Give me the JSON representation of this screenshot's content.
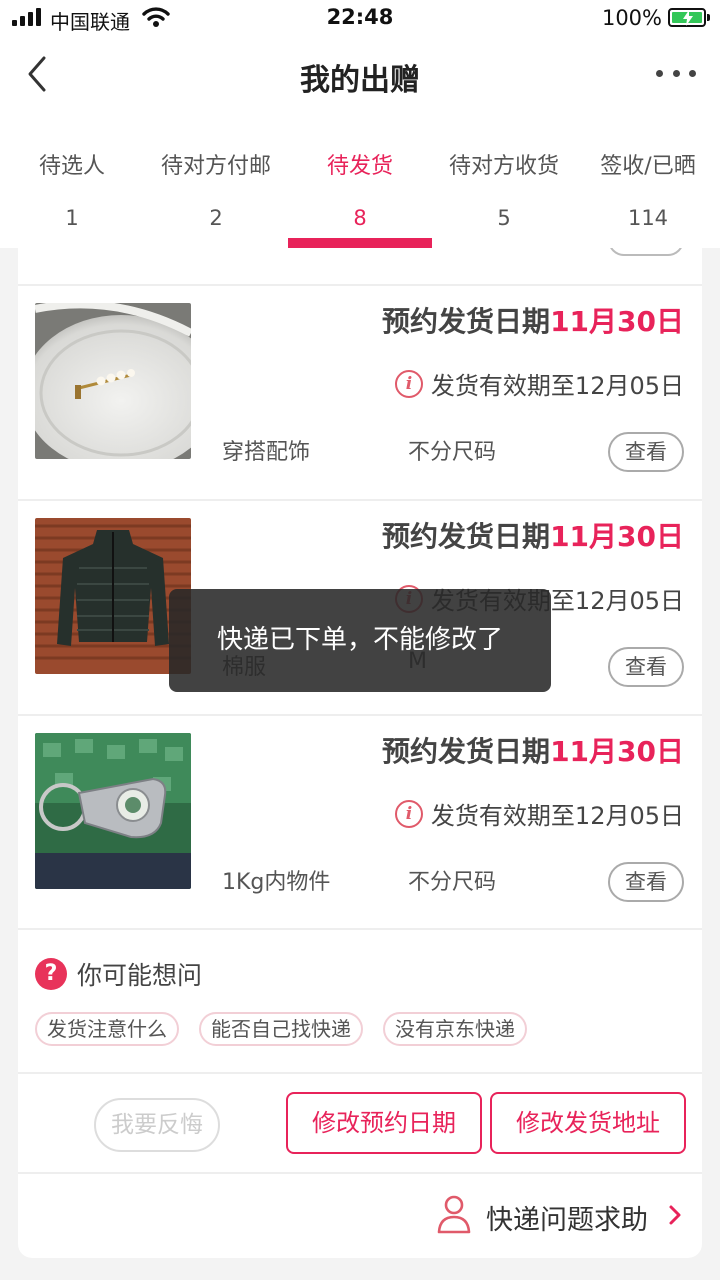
{
  "status_bar": {
    "carrier": "中国联通",
    "time": "22:48",
    "battery": "100%"
  },
  "header": {
    "title": "我的出赠"
  },
  "tabs": [
    {
      "label": "待选人",
      "count": "1"
    },
    {
      "label": "待对方付邮",
      "count": "2"
    },
    {
      "label": "待发货",
      "count": "8"
    },
    {
      "label": "待对方收货",
      "count": "5"
    },
    {
      "label": "签收/已晒",
      "count": "114"
    }
  ],
  "items": [
    {
      "date_label": "预约发货日期",
      "date_value": "11月30日",
      "valid_text": "发货有效期至12月05日",
      "category": "穿搭配饰",
      "size": "不分尺码",
      "view_label": "查看",
      "image": "earring-photo"
    },
    {
      "date_label": "预约发货日期",
      "date_value": "11月30日",
      "valid_text": "发货有效期至12月05日",
      "category": "棉服",
      "size": "M",
      "view_label": "查看",
      "image": "jacket-photo"
    },
    {
      "date_label": "预约发货日期",
      "date_value": "11月30日",
      "valid_text": "发货有效期至12月05日",
      "category": "1Kg内物件",
      "size": "不分尺码",
      "view_label": "查看",
      "image": "nail-clipper-photo"
    }
  ],
  "faq": {
    "title": "你可能想问",
    "tags": [
      "发货注意什么",
      "能否自己找快递",
      "没有京东快递"
    ]
  },
  "actions": {
    "regret": "我要反悔",
    "modify_date": "修改预约日期",
    "modify_address": "修改发货地址"
  },
  "help": {
    "label": "快递问题求助"
  },
  "toast": {
    "message": "快递已下单，不能修改了"
  },
  "colors": {
    "accent": "#e8235a",
    "success": "#34c759"
  }
}
